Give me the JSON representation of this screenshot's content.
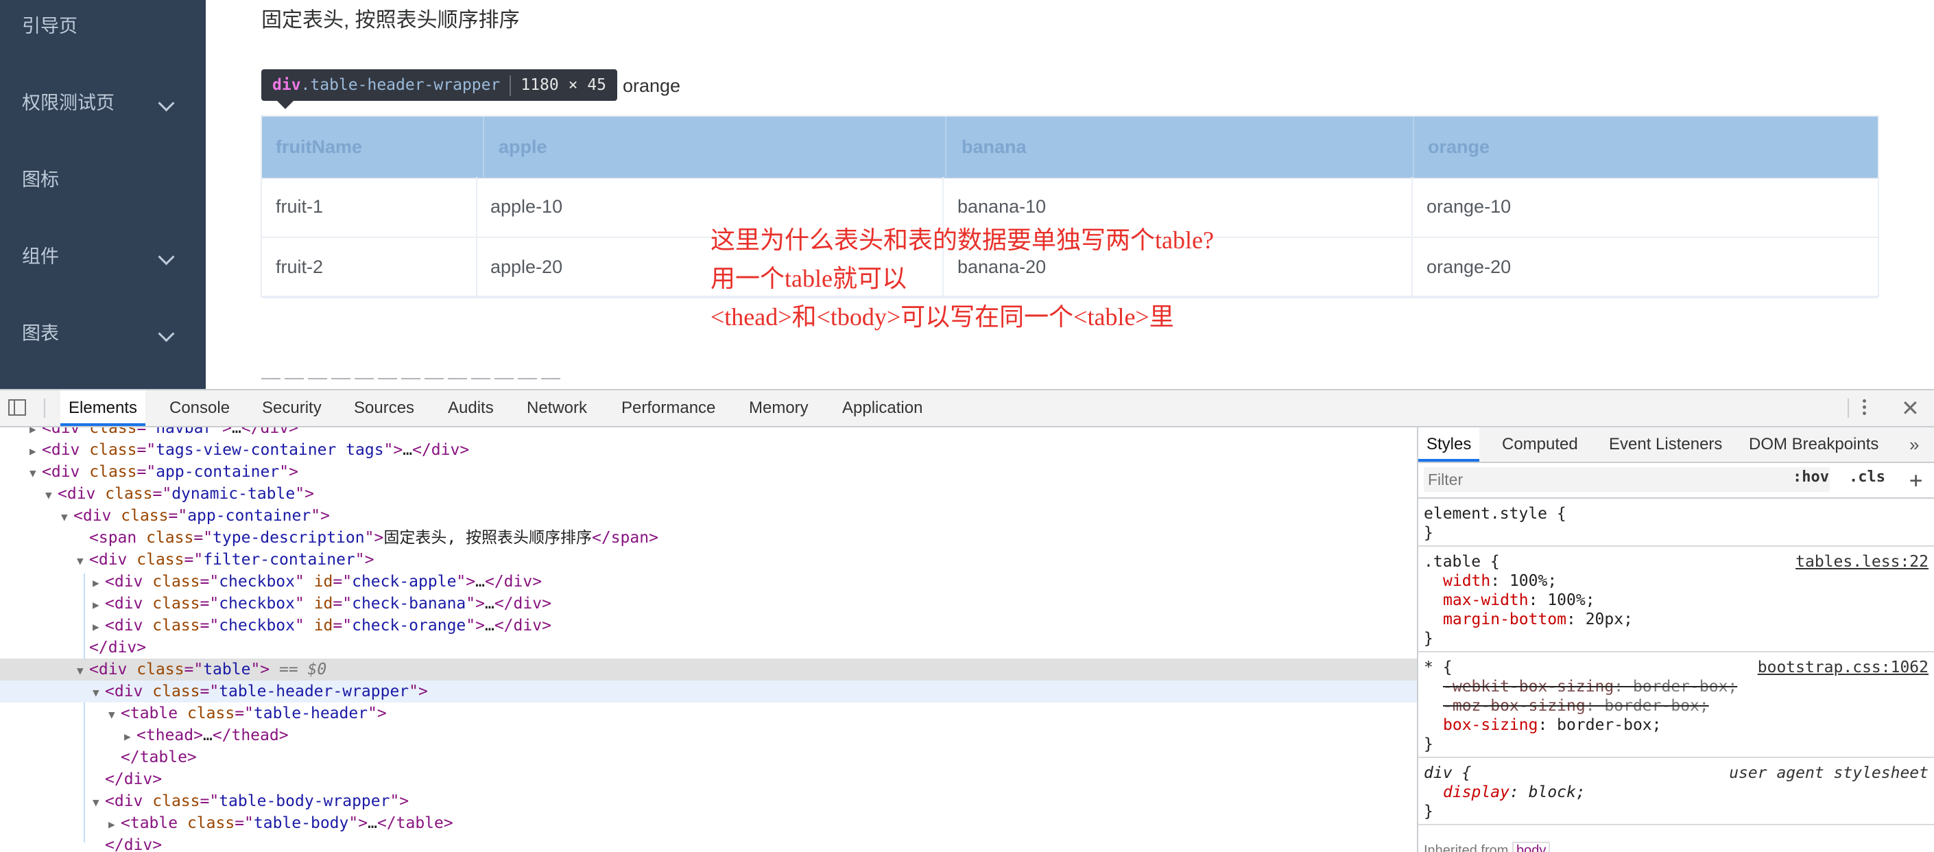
{
  "sidebar": {
    "items": [
      {
        "label": "引导页",
        "icon": "guide-icon",
        "expandable": false
      },
      {
        "label": "权限测试页",
        "icon": "lock-icon",
        "expandable": true
      },
      {
        "label": "图标",
        "icon": "icons-icon",
        "expandable": false
      },
      {
        "label": "组件",
        "icon": "component-icon",
        "expandable": true
      },
      {
        "label": "图表",
        "icon": "chart-icon",
        "expandable": true
      }
    ]
  },
  "main": {
    "type_description": "固定表头, 按照表头顺序排序",
    "tooltip": {
      "tag": "div",
      "class_name": ".table-header-wrapper",
      "size": "1180 × 45"
    },
    "filter_visible_label": "orange",
    "table": {
      "headers": [
        "fruitName",
        "apple",
        "banana",
        "orange"
      ],
      "rows": [
        [
          "fruit-1",
          "apple-10",
          "banana-10",
          "orange-10"
        ],
        [
          "fruit-2",
          "apple-20",
          "banana-20",
          "orange-20"
        ]
      ]
    },
    "annotation": [
      "这里为什么表头和表的数据要单独写两个table?",
      "用一个table就可以",
      "<thead>和<tbody>可以写在同一个<table>里"
    ]
  },
  "devtools": {
    "tabs": [
      "Elements",
      "Console",
      "Security",
      "Sources",
      "Audits",
      "Network",
      "Performance",
      "Memory",
      "Application"
    ],
    "active_tab": "Elements",
    "dom_lines": [
      {
        "indent": 1,
        "tri": "▶",
        "parts": [
          [
            "tag",
            "<div "
          ],
          [
            "attr",
            "class"
          ],
          [
            "tag",
            "=\""
          ],
          [
            "val",
            "navbar"
          ],
          [
            "tag",
            "\">"
          ],
          [
            "text",
            "…"
          ],
          [
            "tag",
            "</div>"
          ]
        ]
      },
      {
        "indent": 1,
        "tri": "▶",
        "parts": [
          [
            "tag",
            "<div "
          ],
          [
            "attr",
            "class"
          ],
          [
            "tag",
            "=\""
          ],
          [
            "val",
            "tags-view-container tags"
          ],
          [
            "tag",
            "\">"
          ],
          [
            "text",
            "…"
          ],
          [
            "tag",
            "</div>"
          ]
        ]
      },
      {
        "indent": 1,
        "tri": "▼",
        "parts": [
          [
            "tag",
            "<div "
          ],
          [
            "attr",
            "class"
          ],
          [
            "tag",
            "=\""
          ],
          [
            "val",
            "app-container"
          ],
          [
            "tag",
            "\">"
          ]
        ]
      },
      {
        "indent": 2,
        "tri": "▼",
        "parts": [
          [
            "tag",
            "<div "
          ],
          [
            "attr",
            "class"
          ],
          [
            "tag",
            "=\""
          ],
          [
            "val",
            "dynamic-table"
          ],
          [
            "tag",
            "\">"
          ]
        ]
      },
      {
        "indent": 3,
        "tri": "▼",
        "parts": [
          [
            "tag",
            "<div "
          ],
          [
            "attr",
            "class"
          ],
          [
            "tag",
            "=\""
          ],
          [
            "val",
            "app-container"
          ],
          [
            "tag",
            "\">"
          ]
        ]
      },
      {
        "indent": 4,
        "tri": "",
        "parts": [
          [
            "tag",
            "<span "
          ],
          [
            "attr",
            "class"
          ],
          [
            "tag",
            "=\""
          ],
          [
            "val",
            "type-description"
          ],
          [
            "tag",
            "\">"
          ],
          [
            "text",
            "固定表头, 按照表头顺序排序"
          ],
          [
            "tag",
            "</span>"
          ]
        ]
      },
      {
        "indent": 4,
        "tri": "▼",
        "parts": [
          [
            "tag",
            "<div "
          ],
          [
            "attr",
            "class"
          ],
          [
            "tag",
            "=\""
          ],
          [
            "val",
            "filter-container"
          ],
          [
            "tag",
            "\">"
          ]
        ]
      },
      {
        "indent": 5,
        "tri": "▶",
        "parts": [
          [
            "tag",
            "<div "
          ],
          [
            "attr",
            "class"
          ],
          [
            "tag",
            "=\""
          ],
          [
            "val",
            "checkbox"
          ],
          [
            "tag",
            "\" "
          ],
          [
            "attr",
            "id"
          ],
          [
            "tag",
            "=\""
          ],
          [
            "val",
            "check-apple"
          ],
          [
            "tag",
            "\">"
          ],
          [
            "text",
            "…"
          ],
          [
            "tag",
            "</div>"
          ]
        ]
      },
      {
        "indent": 5,
        "tri": "▶",
        "parts": [
          [
            "tag",
            "<div "
          ],
          [
            "attr",
            "class"
          ],
          [
            "tag",
            "=\""
          ],
          [
            "val",
            "checkbox"
          ],
          [
            "tag",
            "\" "
          ],
          [
            "attr",
            "id"
          ],
          [
            "tag",
            "=\""
          ],
          [
            "val",
            "check-banana"
          ],
          [
            "tag",
            "\">"
          ],
          [
            "text",
            "…"
          ],
          [
            "tag",
            "</div>"
          ]
        ]
      },
      {
        "indent": 5,
        "tri": "▶",
        "parts": [
          [
            "tag",
            "<div "
          ],
          [
            "attr",
            "class"
          ],
          [
            "tag",
            "=\""
          ],
          [
            "val",
            "checkbox"
          ],
          [
            "tag",
            "\" "
          ],
          [
            "attr",
            "id"
          ],
          [
            "tag",
            "=\""
          ],
          [
            "val",
            "check-orange"
          ],
          [
            "tag",
            "\">"
          ],
          [
            "text",
            "…"
          ],
          [
            "tag",
            "</div>"
          ]
        ]
      },
      {
        "indent": 4,
        "tri": "",
        "parts": [
          [
            "tag",
            "</div>"
          ]
        ]
      },
      {
        "indent": 4,
        "tri": "▼",
        "sel": true,
        "parts": [
          [
            "tag",
            "<div "
          ],
          [
            "attr",
            "class"
          ],
          [
            "tag",
            "=\""
          ],
          [
            "val",
            "table"
          ],
          [
            "tag",
            "\">"
          ],
          [
            "dim",
            " == $0"
          ]
        ]
      },
      {
        "indent": 5,
        "tri": "▼",
        "hov": true,
        "parts": [
          [
            "tag",
            "<div "
          ],
          [
            "attr",
            "class"
          ],
          [
            "tag",
            "=\""
          ],
          [
            "val",
            "table-header-wrapper"
          ],
          [
            "tag",
            "\">"
          ]
        ]
      },
      {
        "indent": 6,
        "tri": "▼",
        "parts": [
          [
            "tag",
            "<table "
          ],
          [
            "attr",
            "class"
          ],
          [
            "tag",
            "=\""
          ],
          [
            "val",
            "table-header"
          ],
          [
            "tag",
            "\">"
          ]
        ]
      },
      {
        "indent": 7,
        "tri": "▶",
        "parts": [
          [
            "tag",
            "<thead>"
          ],
          [
            "text",
            "…"
          ],
          [
            "tag",
            "</thead>"
          ]
        ]
      },
      {
        "indent": 6,
        "tri": "",
        "parts": [
          [
            "tag",
            "</table>"
          ]
        ]
      },
      {
        "indent": 5,
        "tri": "",
        "parts": [
          [
            "tag",
            "</div>"
          ]
        ]
      },
      {
        "indent": 5,
        "tri": "▼",
        "parts": [
          [
            "tag",
            "<div "
          ],
          [
            "attr",
            "class"
          ],
          [
            "tag",
            "=\""
          ],
          [
            "val",
            "table-body-wrapper"
          ],
          [
            "tag",
            "\">"
          ]
        ]
      },
      {
        "indent": 6,
        "tri": "▶",
        "parts": [
          [
            "tag",
            "<table "
          ],
          [
            "attr",
            "class"
          ],
          [
            "tag",
            "=\""
          ],
          [
            "val",
            "table-body"
          ],
          [
            "tag",
            "\">"
          ],
          [
            "text",
            "…"
          ],
          [
            "tag",
            "</table>"
          ]
        ]
      },
      {
        "indent": 5,
        "tri": "",
        "parts": [
          [
            "tag",
            "</div>"
          ]
        ]
      }
    ],
    "styles_tabs": [
      "Styles",
      "Computed",
      "Event Listeners",
      "DOM Breakpoints"
    ],
    "styles_more": "»",
    "filter_placeholder": "Filter",
    "hov_label": ":hov",
    "cls_label": ".cls",
    "plus_label": "+",
    "rules": [
      {
        "selector": "element.style {",
        "source": "",
        "ua": "",
        "decls": [],
        "close": "}"
      },
      {
        "selector": ".table {",
        "source": "tables.less:22",
        "ua": "",
        "decls": [
          {
            "prop": "width",
            "value": "100%;",
            "struck": false
          },
          {
            "prop": "max-width",
            "value": "100%;",
            "struck": false
          },
          {
            "prop": "margin-bottom",
            "value": "20px;",
            "struck": false
          }
        ],
        "close": "}"
      },
      {
        "selector": "* {",
        "source": "bootstrap.css:1062",
        "ua": "",
        "decls": [
          {
            "prop": "-webkit-box-sizing",
            "value": "border-box;",
            "struck": true
          },
          {
            "prop": "-moz-box-sizing",
            "value": "border-box;",
            "struck": true
          },
          {
            "prop": "box-sizing",
            "value": "border-box;",
            "struck": false
          }
        ],
        "close": "}"
      },
      {
        "selector": "div {",
        "source": "",
        "ua": "user agent stylesheet",
        "decls": [
          {
            "prop": "display",
            "value": "block;",
            "struck": false
          }
        ],
        "close": "}"
      }
    ],
    "inherited_label": "Inherited from",
    "inherited_from": "body"
  }
}
